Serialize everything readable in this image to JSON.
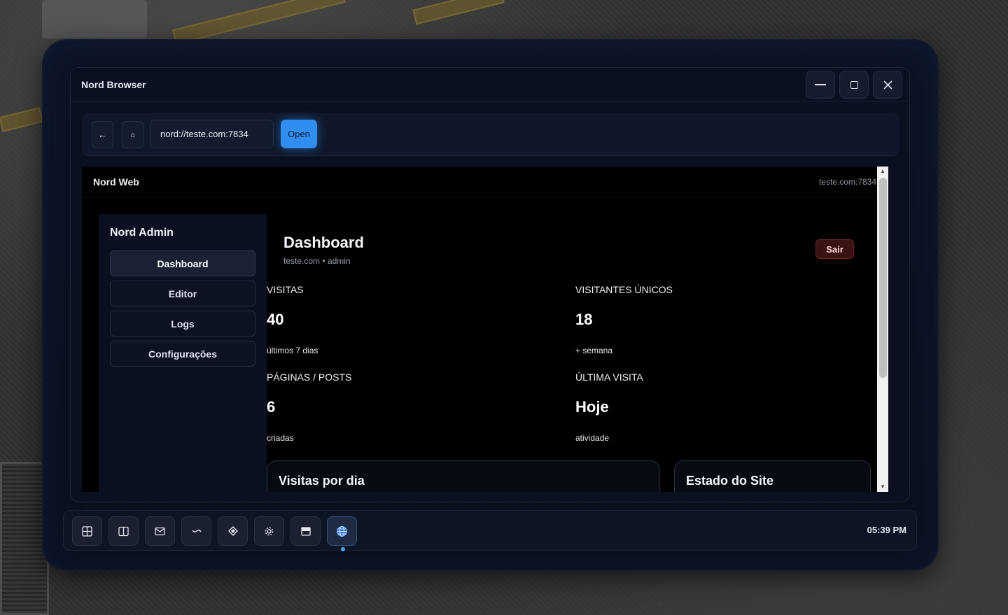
{
  "window": {
    "title": "Nord Browser",
    "controls": {
      "minimize": "—",
      "maximize": "□",
      "close": "✕"
    }
  },
  "toolbar": {
    "back_label": "←",
    "home_label": "⌂",
    "url_value": "nord://teste.com:7834",
    "open_label": "Open"
  },
  "web": {
    "site_title": "Nord Web",
    "host": "teste.com:7834"
  },
  "sidebar": {
    "title": "Nord Admin",
    "items": [
      {
        "label": "Dashboard",
        "active": true
      },
      {
        "label": "Editor",
        "active": false
      },
      {
        "label": "Logs",
        "active": false
      },
      {
        "label": "Configurações",
        "active": false
      }
    ]
  },
  "dashboard": {
    "title": "Dashboard",
    "subtitle": "teste.com • admin",
    "logout_label": "Sair",
    "stats": [
      {
        "label": "VISITAS",
        "value": "40",
        "sub": "últimos 7 dias"
      },
      {
        "label": "VISITANTES ÚNICOS",
        "value": "18",
        "sub": "+ semana"
      },
      {
        "label": "PÁGINAS / POSTS",
        "value": "6",
        "sub": "criadas"
      },
      {
        "label": "ÚLTIMA VISITA",
        "value": "Hoje",
        "sub": "atividade"
      }
    ],
    "cards": [
      {
        "title": "Visitas por dia"
      },
      {
        "title": "Estado do Site"
      }
    ]
  },
  "taskbar": {
    "icons": [
      "grid-icon",
      "columns-icon",
      "mail-icon",
      "wave-icon",
      "diamond-icon",
      "settings-icon",
      "window-icon",
      "globe-icon"
    ],
    "active_icon": "globe-icon",
    "clock": "05:39 PM"
  },
  "colors": {
    "accent": "#2f8eef",
    "danger": "#6b2222",
    "background": "#0b1020"
  }
}
